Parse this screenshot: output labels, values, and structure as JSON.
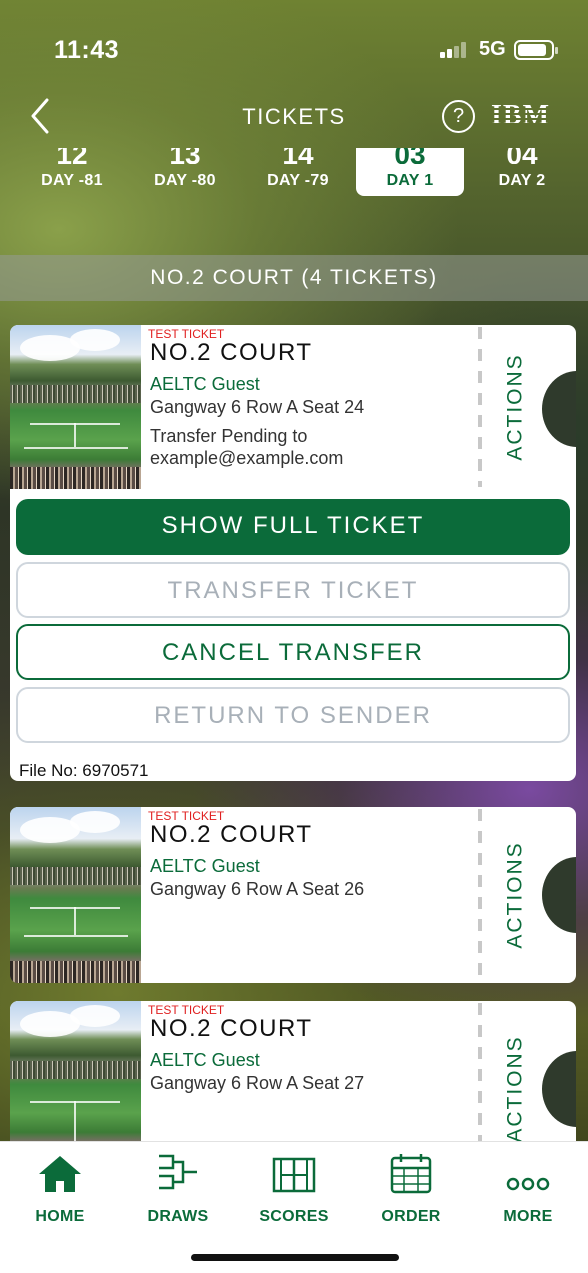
{
  "status_bar": {
    "time": "11:43",
    "network": "5G"
  },
  "header": {
    "title": "TICKETS",
    "help_icon": "?",
    "sponsor_logo": "IBM"
  },
  "day_tabs": [
    {
      "num": "12",
      "label": "DAY -81",
      "active": false
    },
    {
      "num": "13",
      "label": "DAY -80",
      "active": false
    },
    {
      "num": "14",
      "label": "DAY -79",
      "active": false
    },
    {
      "num": "03",
      "label": "DAY 1",
      "active": true
    },
    {
      "num": "04",
      "label": "DAY 2",
      "active": false
    }
  ],
  "court_group_header": "NO.2 COURT (4 TICKETS)",
  "tickets": [
    {
      "test_label": "TEST TICKET",
      "court": "NO.2 COURT",
      "guest_type": "AELTC Guest",
      "seat": "Gangway 6 Row A Seat 24",
      "transfer_note": "Transfer Pending to example@example.com",
      "actions_label": "ACTIONS",
      "buttons": {
        "show_full": "SHOW FULL TICKET",
        "transfer": "TRANSFER TICKET",
        "cancel_transfer": "CANCEL TRANSFER",
        "return_sender": "RETURN TO SENDER"
      },
      "file_no": "File No: 6970571"
    },
    {
      "test_label": "TEST TICKET",
      "court": "NO.2 COURT",
      "guest_type": "AELTC Guest",
      "seat": "Gangway 6 Row A Seat 26",
      "actions_label": "ACTIONS"
    },
    {
      "test_label": "TEST TICKET",
      "court": "NO.2 COURT",
      "guest_type": "AELTC Guest",
      "seat": "Gangway 6 Row A Seat 27",
      "actions_label": "ACTIONS"
    }
  ],
  "bottom_nav": [
    {
      "label": "HOME",
      "icon": "home-icon"
    },
    {
      "label": "DRAWS",
      "icon": "bracket-icon"
    },
    {
      "label": "SCORES",
      "icon": "court-icon"
    },
    {
      "label": "ORDER",
      "icon": "calendar-icon"
    },
    {
      "label": "MORE",
      "icon": "more-dots-icon"
    }
  ],
  "colors": {
    "brand_green": "#0b6b3a",
    "test_red": "#e02020",
    "disabled_grey": "#a8b0b8"
  }
}
